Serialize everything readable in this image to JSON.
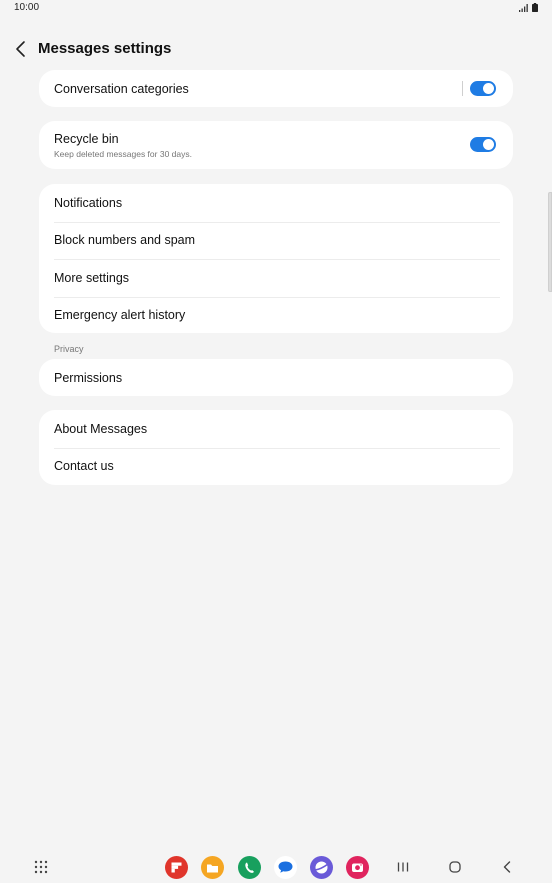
{
  "status_bar": {
    "time": "10:00"
  },
  "header": {
    "title": "Messages settings",
    "back_icon": "back-chevron-icon"
  },
  "cards": {
    "conversation_categories": {
      "label": "Conversation categories",
      "enabled": true
    },
    "recycle_bin": {
      "label": "Recycle bin",
      "sublabel": "Keep deleted messages for 30 days.",
      "enabled": true
    },
    "main_list": [
      {
        "label": "Notifications"
      },
      {
        "label": "Block numbers and spam"
      },
      {
        "label": "More settings"
      },
      {
        "label": "Emergency alert history"
      }
    ],
    "privacy_section_title": "Privacy",
    "privacy_list": [
      {
        "label": "Permissions"
      }
    ],
    "about_list": [
      {
        "label": "About Messages"
      },
      {
        "label": "Contact us"
      }
    ]
  },
  "colors": {
    "accent": "#1f7ce4",
    "background": "#f4f4f4",
    "card": "#ffffff"
  },
  "navbar": {
    "apps": [
      {
        "name": "flipboard-app-icon",
        "color": "#e0352b"
      },
      {
        "name": "my-files-app-icon",
        "color": "#f5a623"
      },
      {
        "name": "phone-app-icon",
        "color": "#18a05e"
      },
      {
        "name": "messages-app-icon",
        "color": "#1a6fe0"
      },
      {
        "name": "internet-app-icon",
        "color": "#6a5ad8"
      },
      {
        "name": "camera-app-icon",
        "color": "#e0245e"
      }
    ]
  }
}
